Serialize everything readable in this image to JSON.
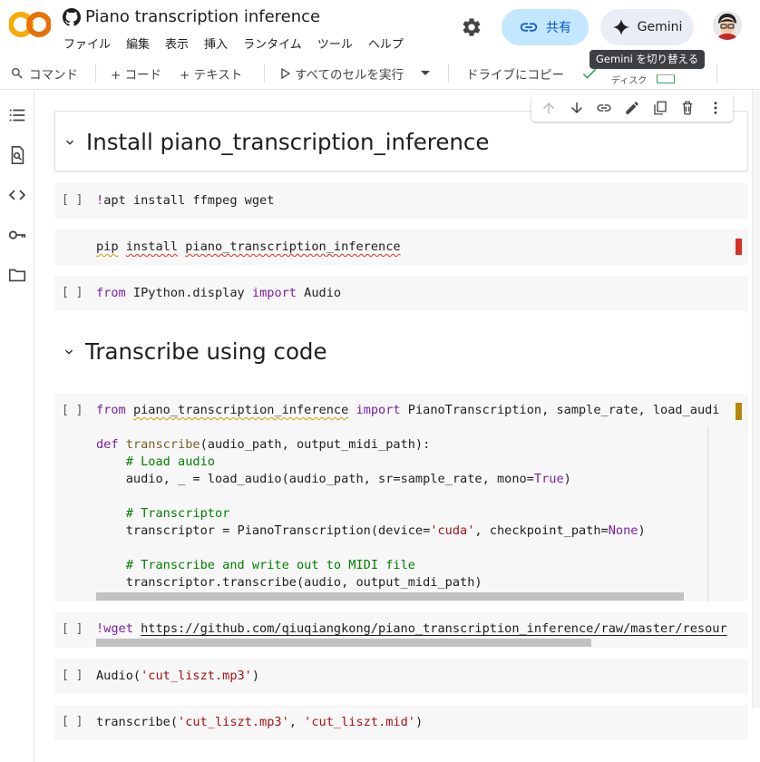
{
  "header": {
    "title": "Piano transcription inference",
    "menu": [
      "ファイル",
      "編集",
      "表示",
      "挿入",
      "ランタイム",
      "ツール",
      "ヘルプ"
    ],
    "share_label": "共有",
    "gemini_label": "Gemini",
    "gemini_tooltip": "Gemini を切り替える"
  },
  "toolbar": {
    "command_label": "コマンド",
    "add_code_label": "+ コード",
    "add_text_label": "+ テキスト",
    "run_all_label": "すべてのセルを実行",
    "copy_to_drive_label": "ドライブにコピー",
    "disk_label": "ディスク"
  },
  "sections": [
    {
      "heading": "Install piano_transcription_inference"
    },
    {
      "heading": "Transcribe using code"
    }
  ],
  "cells": {
    "run_bracket": "[ ]",
    "c1": {
      "bang": "!",
      "rest": "apt install ffmpeg wget"
    },
    "c2": {
      "w1": "pip",
      "w2": "install",
      "w3": "piano_transcription_inference"
    },
    "c3": {
      "from": "from",
      "mod": " IPython.display ",
      "imp": "import",
      "name": " Audio"
    },
    "c4": {
      "l1_from": "from",
      "l1_mod": "piano_transcription_inference",
      "l1_imp": "import",
      "l1_rest": " PianoTranscription, sample_rate, load_audi",
      "l2_def": "def",
      "l2_fn": "transcribe",
      "l2_args": "(audio_path, output_midi_path):",
      "l3": "# Load audio",
      "l4_a": "audio, _ = load_audio(audio_path, sr=sample_rate, mono=",
      "l4_true": "True",
      "l4_end": ")",
      "l5": "# Transcriptor",
      "l6_a": "transcriptor = PianoTranscription(device=",
      "l6_str": "'cuda'",
      "l6_b": ", checkpoint_path=",
      "l6_none": "None",
      "l6_end": ")",
      "l7": "# Transcribe and write out to MIDI file",
      "l8": "transcriptor.transcribe(audio, output_midi_path)"
    },
    "c5": {
      "bang": "!wget",
      "url": "https://github.com/qiuqiangkong/piano_transcription_inference/raw/master/resour"
    },
    "c6": {
      "fn": "Audio(",
      "str": "'cut_liszt.mp3'",
      "end": ")"
    },
    "c7": {
      "fn": "transcribe(",
      "s1": "'cut_liszt.mp3'",
      "mid": ", ",
      "s2": "'cut_liszt.mid'",
      "end": ")"
    }
  },
  "colors": {
    "share_bg": "#c2e7ff",
    "share_text": "#0b57d0",
    "keyword": "#7b1fa2",
    "string": "#a31515",
    "comment": "#008000"
  }
}
